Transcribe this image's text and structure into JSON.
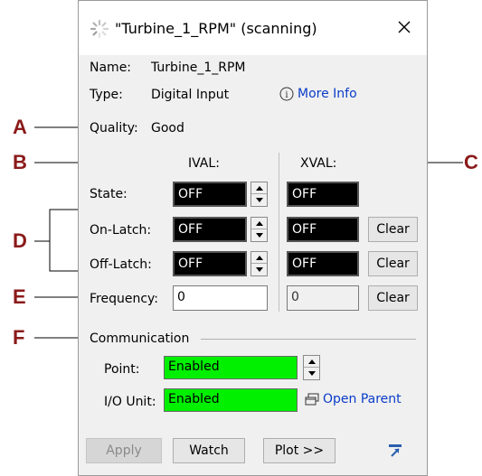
{
  "window": {
    "title": "\"Turbine_1_RPM\" (scanning)"
  },
  "info": {
    "name_label": "Name:",
    "name_value": "Turbine_1_RPM",
    "type_label": "Type:",
    "type_value": "Digital Input",
    "more_info": "More Info",
    "quality_label": "Quality:",
    "quality_value": "Good"
  },
  "columns": {
    "ival": "IVAL:",
    "xval": "XVAL:"
  },
  "rows": {
    "state_label": "State:",
    "state_ival": "OFF",
    "state_xval": "OFF",
    "on_latch_label": "On-Latch:",
    "on_latch_ival": "OFF",
    "on_latch_xval": "OFF",
    "off_latch_label": "Off-Latch:",
    "off_latch_ival": "OFF",
    "off_latch_xval": "OFF",
    "frequency_label": "Frequency:",
    "frequency_ival": "0",
    "frequency_xval": "0",
    "clear_label": "Clear"
  },
  "communication": {
    "section_label": "Communication",
    "point_label": "Point:",
    "point_value": "Enabled",
    "io_unit_label": "I/O Unit:",
    "io_unit_value": "Enabled",
    "open_parent": "Open Parent"
  },
  "buttons": {
    "apply": "Apply",
    "watch": "Watch",
    "plot": "Plot >>"
  },
  "callouts": {
    "a": "A",
    "b": "B",
    "c": "C",
    "d": "D",
    "e": "E",
    "f": "F"
  },
  "colors": {
    "callout": "#8b1a1a",
    "link": "#0a3cc8",
    "enabled_green": "#00f000"
  },
  "icons": {
    "spinner": "spinner-icon",
    "close": "close-icon",
    "info": "info-icon",
    "open_parent": "open-parent-icon",
    "pin": "pin-icon"
  }
}
